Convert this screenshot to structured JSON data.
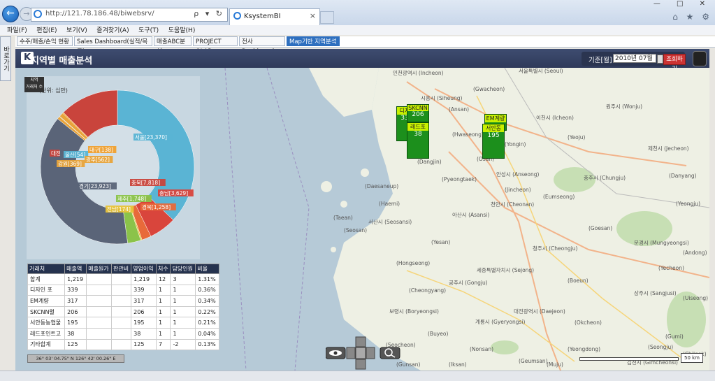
{
  "browser": {
    "url": "http://121.78.186.48/biwebsrv/",
    "tab_title": "KsystemBI",
    "tab_close": "×",
    "back_glyph": "←",
    "forward_glyph": "→",
    "addr_controls": "ρ ▾ ↻",
    "window_controls": "— □ ✕",
    "right_icons": "⌂ ★ ⚙"
  },
  "menu": [
    "파일(F)",
    "편집(E)",
    "보기(V)",
    "즐겨찾기(A)",
    "도구(T)",
    "도움말(H)"
  ],
  "side_tab": "바로가기",
  "app_tabs": [
    {
      "label": "수주/매출/손익 현황",
      "active": false
    },
    {
      "label": "Sales Dashboard(실적/목표)",
      "active": false
    },
    {
      "label": "매출ABC분석",
      "active": false
    },
    {
      "label": "PROJECT OLAP",
      "active": false
    },
    {
      "label": "전사 Dashboard",
      "active": false
    },
    {
      "label": "Map기반 지역분석 X",
      "active": true
    }
  ],
  "header": {
    "title": "지역별 매출분석",
    "period_label": "기준[월]",
    "period_value": "2010년 07월",
    "query_button": "조회하기"
  },
  "chart_panel": {
    "tooltip": [
      "지역",
      "거래처 수"
    ],
    "unit_label": "(단위: 십만)"
  },
  "chart_data": {
    "type": "pie",
    "slices": [
      {
        "label": "서울",
        "value": 23370,
        "display": "서울[23,370]",
        "color": "#5ab4d4"
      },
      {
        "label": "충남",
        "value": 3629,
        "display": "충남[3,629]",
        "color": "#d9453c"
      },
      {
        "label": "경북",
        "value": 1258,
        "display": "경북[1,258]",
        "color": "#e86a3a"
      },
      {
        "label": "전남",
        "value": 174,
        "display": "전남[174]",
        "color": "#e8c33a"
      },
      {
        "label": "제주",
        "value": 1748,
        "display": "제주[1,748]",
        "color": "#8bc34a"
      },
      {
        "label": "경기",
        "value": 23923,
        "display": "경기[23,923]",
        "color": "#5a6478"
      },
      {
        "label": "강원",
        "value": 369,
        "display": "강원[369]",
        "color": "#e8a33a"
      },
      {
        "label": "대전",
        "value": null,
        "display": "대전",
        "color": "#c9443c"
      },
      {
        "label": "울산",
        "value": 54,
        "display": "울산[54]",
        "color": "#5ab4d4"
      },
      {
        "label": "광주",
        "value": 562,
        "display": "광주[562]",
        "color": "#e8a33a"
      },
      {
        "label": "대구",
        "value": 138,
        "display": "대구[138]",
        "color": "#f0a030"
      },
      {
        "label": "충북",
        "value": 7818,
        "display": "충북[7,818]",
        "color": "#c9443c"
      }
    ]
  },
  "table": {
    "columns": [
      "거래처",
      "매출액",
      "매출원가",
      "판관비",
      "영업이익",
      "처수",
      "담당인원",
      "비율"
    ],
    "rows": [
      [
        "합계",
        "1,219",
        "",
        "",
        "1,219",
        "12",
        "3",
        "1.31%"
      ],
      [
        "디자인 포",
        "339",
        "",
        "",
        "339",
        "1",
        "1",
        "0.36%"
      ],
      [
        "EM계량",
        "317",
        "",
        "",
        "317",
        "1",
        "1",
        "0.34%"
      ],
      [
        "SKCNN렬",
        "206",
        "",
        "",
        "206",
        "1",
        "1",
        "0.22%"
      ],
      [
        "서안동농협물",
        "195",
        "",
        "",
        "195",
        "1",
        "1",
        "0.21%"
      ],
      [
        "레드포인트고",
        "38",
        "",
        "",
        "38",
        "1",
        "1",
        "0.04%"
      ],
      [
        "기타합계",
        "125",
        "",
        "",
        "125",
        "7",
        "-2",
        "0.13%"
      ]
    ]
  },
  "map": {
    "coordinates": "36° 03' 04.75\" N 126° 42' 00.26\" E",
    "scale": "50 km",
    "markers": [
      {
        "name": "디자",
        "value": "33"
      },
      {
        "name": "SKCNN",
        "value": "206"
      },
      {
        "name": "레드포",
        "value": "38"
      },
      {
        "name": "EM계량",
        "value": ""
      },
      {
        "name": "서안동",
        "value": "195"
      }
    ],
    "cities": [
      "인천광역시 (Incheon)",
      "서울특별시 (Seoul)",
      "(Gwacheon)",
      "(Ansan)",
      "시흥시 (Siheung)",
      "이천시 (Icheon)",
      "원주시 (Wonju)",
      "(Hwaseong)",
      "안성시 (Anseong)",
      "충주시 (Chungju)",
      "제천시 (Jecheon)",
      "아산시 (Asansi)",
      "천안시 (Cheonan)",
      "서산시 (Seosansi)",
      "청주시 (Cheongju)",
      "문경시 (Mungyeongsi)",
      "세종특별자치시 (Sejong)",
      "공주시 (Gongju)",
      "보령시 (Boryeongsi)",
      "대전광역시 (Daejeon)",
      "계룡시 (Gyeryongsi)",
      "상주시 (Sangjusi)",
      "김천시 (Gimcheonsi)",
      "(Dangjin)",
      "(Taean)",
      "(Hongseong)",
      "(Yesan)",
      "(Cheongyang)",
      "(Buyeo)",
      "(Nonsan)",
      "(Okcheon)",
      "(Yeongdong)",
      "(Boeun)",
      "(Goesan)",
      "(Eumseong)",
      "(Jincheon)",
      "(Yongin)",
      "(Pyeongtaek)",
      "(Osan)",
      "(Yeoju)",
      "(Danyang)",
      "(Yeongju)",
      "(Yecheon)",
      "(Andong)",
      "(Uiseong)",
      "(Gumi)",
      "(Chilgok)",
      "(Seongju)",
      "(Muju)",
      "(Geumsan)",
      "(Iksan)",
      "(Gunsan)",
      "(Seocheon)",
      "(Daesaneup)",
      "(Haemi)",
      "(Seosan)"
    ]
  },
  "colors": {
    "header_bg": "#2f3a5a",
    "active_tab": "#2e6fbf",
    "marker_green": "#1c8f1c",
    "query_button": "#cc3333"
  }
}
